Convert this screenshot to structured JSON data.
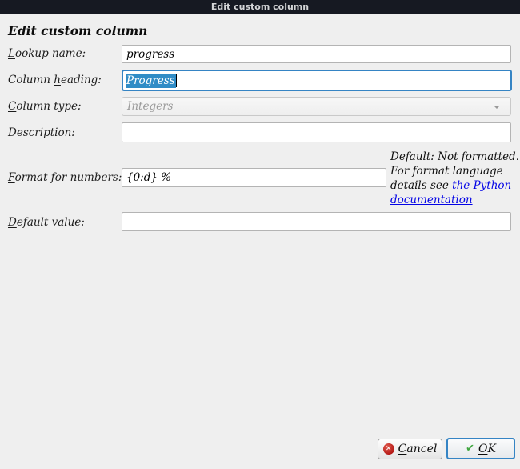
{
  "titlebar": {
    "title": "Edit custom column"
  },
  "heading": "Edit custom column",
  "fields": {
    "lookup_name": {
      "label": {
        "pre": "",
        "mnemonic": "L",
        "post": "ookup name:"
      },
      "value": "progress"
    },
    "column_heading": {
      "label": {
        "pre": "Column ",
        "mnemonic": "h",
        "post": "eading:"
      },
      "value": "Progress",
      "state": "focused, text selected"
    },
    "column_type": {
      "label": {
        "pre": "",
        "mnemonic": "C",
        "post": "olumn type:"
      },
      "value": "Integers",
      "state": "disabled"
    },
    "description": {
      "label": {
        "pre": "D",
        "mnemonic": "e",
        "post": "scription:"
      },
      "value": ""
    },
    "format_numbers": {
      "label": {
        "pre": "",
        "mnemonic": "F",
        "post": "ormat for numbers:"
      },
      "value": "{0:d} %"
    },
    "default_value": {
      "label": {
        "pre": "",
        "mnemonic": "D",
        "post": "efault value:"
      },
      "value": ""
    }
  },
  "help": {
    "line1": "Default: Not formatted.",
    "line2": "For format language",
    "line3_text": "details see ",
    "link_line1": "the Python",
    "link_line2": "documentation"
  },
  "buttons": {
    "cancel": {
      "pre": "",
      "mnemonic": "C",
      "post": "ancel",
      "icon": "red-circle-x"
    },
    "ok": {
      "pre": "",
      "mnemonic": "O",
      "post": "K",
      "icon": "green-check"
    }
  },
  "icons": {
    "cancel_glyph": "✕",
    "ok_glyph": "✔",
    "combo_arrow": "chevron-down"
  },
  "colors": {
    "background": "#efefef",
    "titlebar_bg": "#161922",
    "focus_accent": "#3584c4",
    "selection": "#308cc6",
    "link": "#0404e6",
    "cancel_icon": "#a40000",
    "ok_icon": "#3fa63f"
  }
}
